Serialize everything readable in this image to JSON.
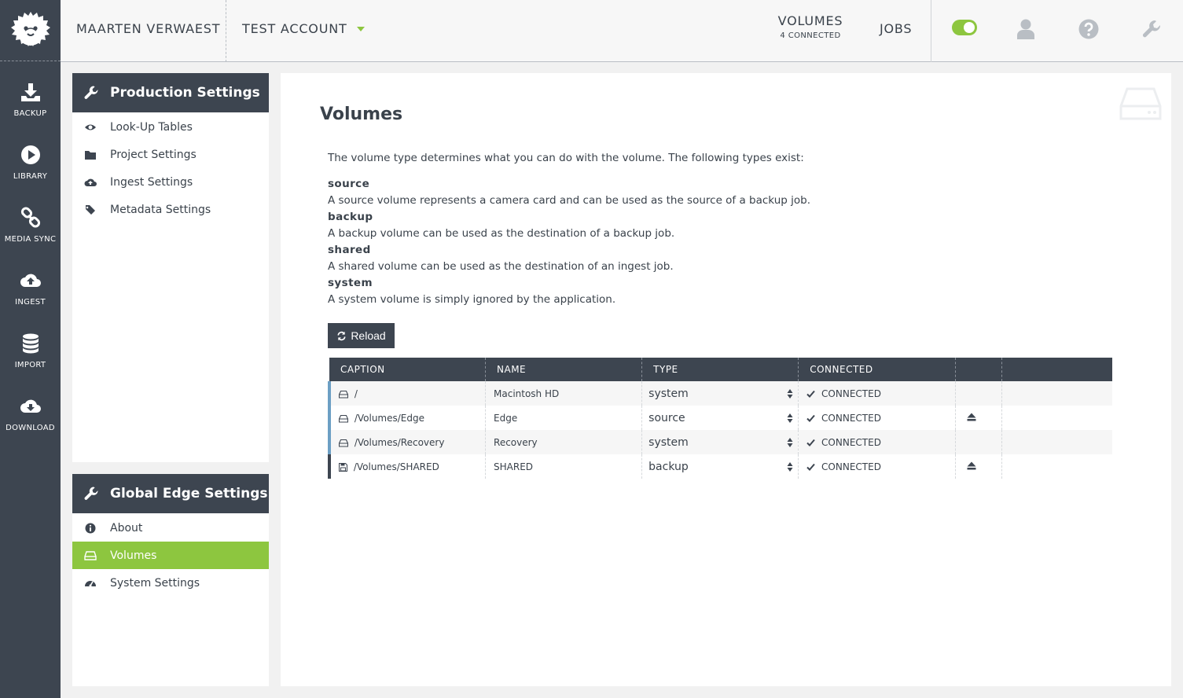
{
  "colors": {
    "dark": "#3d4550",
    "accent": "#8dc63f",
    "row_marker": "#6c9fc4"
  },
  "nav": [
    {
      "label": "BACKUP",
      "icon": "download-tray-icon"
    },
    {
      "label": "LIBRARY",
      "icon": "play-icon"
    },
    {
      "label": "MEDIA SYNC",
      "icon": "link-icon"
    },
    {
      "label": "INGEST",
      "icon": "cloud-upload-icon"
    },
    {
      "label": "IMPORT",
      "icon": "database-icon"
    },
    {
      "label": "DOWNLOAD",
      "icon": "cloud-download-icon"
    }
  ],
  "topbar": {
    "user": "MAARTEN VERWAEST",
    "account": "TEST ACCOUNT",
    "volumes_title": "VOLUMES",
    "volumes_sub": "4 CONNECTED",
    "jobs": "JOBS",
    "toggle_on": true
  },
  "production": {
    "title": "Production Settings",
    "items": [
      {
        "label": "Look-Up Tables",
        "icon": "eye-icon"
      },
      {
        "label": "Project Settings",
        "icon": "folder-icon"
      },
      {
        "label": "Ingest Settings",
        "icon": "cloud-upload-icon"
      },
      {
        "label": "Metadata Settings",
        "icon": "tags-icon"
      }
    ]
  },
  "global": {
    "title": "Global Edge Settings",
    "items": [
      {
        "label": "About",
        "icon": "info-icon",
        "active": false
      },
      {
        "label": "Volumes",
        "icon": "hdd-icon",
        "active": true
      },
      {
        "label": "System Settings",
        "icon": "dashboard-icon",
        "active": false
      }
    ]
  },
  "main": {
    "title": "Volumes",
    "intro": "The volume type determines what you can do with the volume. The following types exist:",
    "types": [
      {
        "name": "source",
        "desc": "A source volume represents a camera card and can be used as the source of a backup job."
      },
      {
        "name": "backup",
        "desc": "A backup volume can be used as the destination of a backup job."
      },
      {
        "name": "shared",
        "desc": "A shared volume can be used as the destination of an ingest job."
      },
      {
        "name": "system",
        "desc": "A system volume is simply ignored by the application."
      }
    ],
    "reload": "Reload"
  },
  "table": {
    "headers": [
      "CAPTION",
      "NAME",
      "TYPE",
      "CONNECTED",
      "",
      ""
    ],
    "rows": [
      {
        "caption": "/",
        "name": "Macintosh HD",
        "type": "system",
        "connected": "CONNECTED",
        "eject": false,
        "icon": "hdd-icon"
      },
      {
        "caption": "/Volumes/Edge",
        "name": "Edge",
        "type": "source",
        "connected": "CONNECTED",
        "eject": true,
        "icon": "hdd-icon"
      },
      {
        "caption": "/Volumes/Recovery",
        "name": "Recovery",
        "type": "system",
        "connected": "CONNECTED",
        "eject": false,
        "icon": "hdd-icon"
      },
      {
        "caption": "/Volumes/SHARED",
        "name": "SHARED",
        "type": "backup",
        "connected": "CONNECTED",
        "eject": true,
        "icon": "save-icon"
      }
    ]
  }
}
